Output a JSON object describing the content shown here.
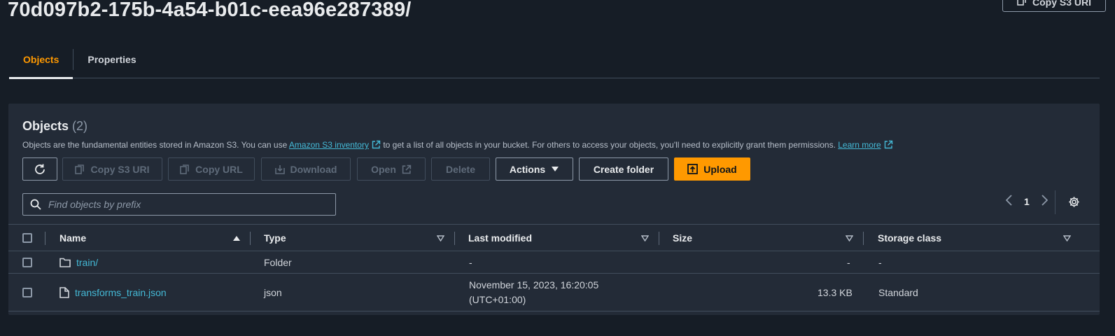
{
  "header": {
    "prefix_title": "70d097b2-175b-4a54-b01c-eea96e287389/",
    "copy_s3_uri_label": "Copy S3 URI"
  },
  "tabs": [
    {
      "label": "Objects",
      "active": true
    },
    {
      "label": "Properties",
      "active": false
    }
  ],
  "objects_panel": {
    "heading": "Objects",
    "count": "(2)",
    "description_prefix": "Objects are the fundamental entities stored in Amazon S3. You can use ",
    "inventory_link": "Amazon S3 inventory",
    "description_middle": " to get a list of all objects in your bucket. For others to access your objects, you'll need to explicitly grant them permissions. ",
    "learn_more_link": "Learn more",
    "toolbar": {
      "refresh_icon": "refresh-icon",
      "copy_s3_uri": "Copy S3 URI",
      "copy_url": "Copy URL",
      "download": "Download",
      "open": "Open",
      "delete": "Delete",
      "actions": "Actions",
      "create_folder": "Create folder",
      "upload": "Upload"
    },
    "search": {
      "placeholder": "Find objects by prefix",
      "value": ""
    },
    "pagination": {
      "current_page": "1"
    }
  },
  "table": {
    "columns": [
      "Name",
      "Type",
      "Last modified",
      "Size",
      "Storage class"
    ],
    "rows": [
      {
        "icon": "folder-icon",
        "name": "train/",
        "type": "Folder",
        "last_modified": "-",
        "last_modified_2": "",
        "size": "-",
        "storage_class": "-"
      },
      {
        "icon": "file-icon",
        "name": "transforms_train.json",
        "type": "json",
        "last_modified": "November 15, 2023, 16:20:05",
        "last_modified_2": "(UTC+01:00)",
        "size": "13.3 KB",
        "storage_class": "Standard"
      }
    ]
  },
  "colors": {
    "accent": "#ff9900",
    "link": "#44b9d6",
    "background": "#161d26",
    "panel": "#232b37"
  }
}
